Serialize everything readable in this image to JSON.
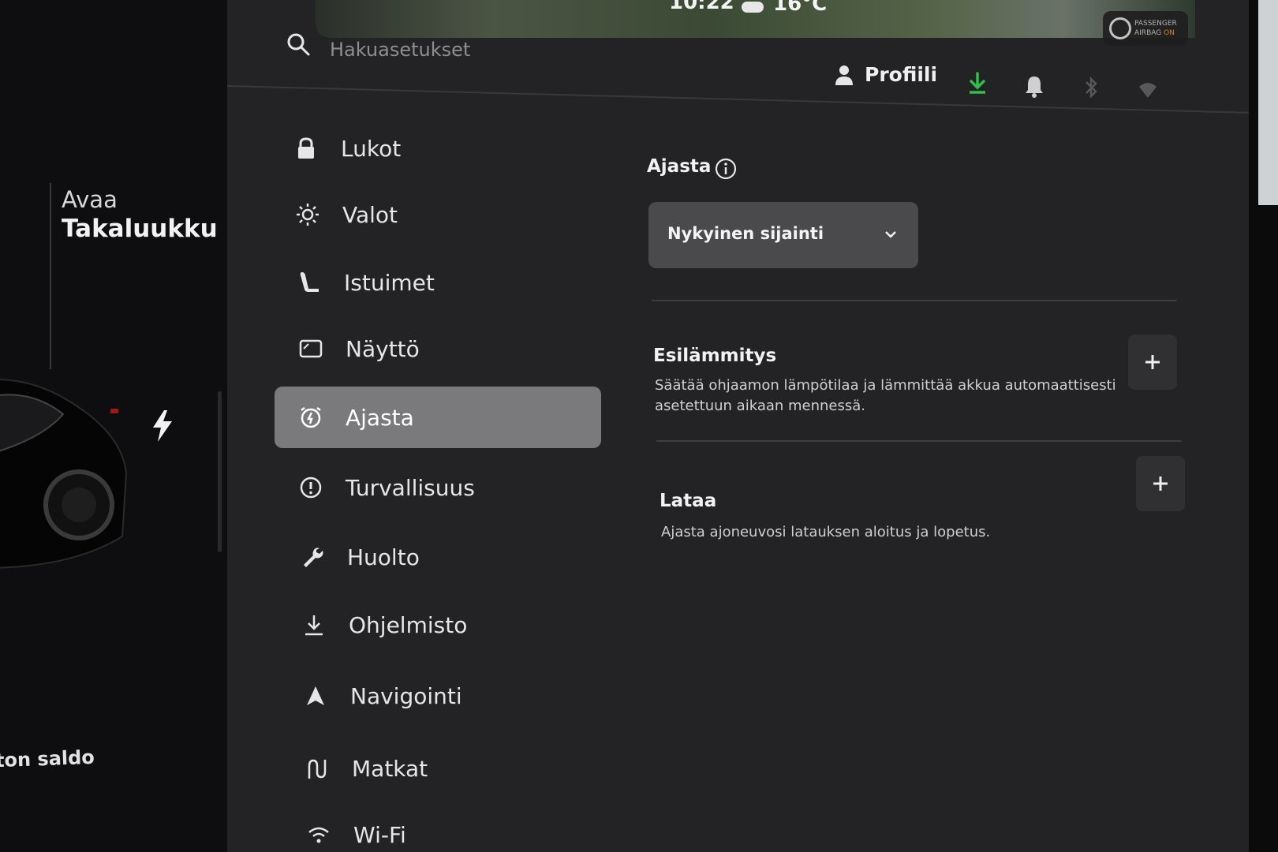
{
  "car_pane": {
    "trunk_action": "Avaa",
    "trunk_name": "Takaluukku",
    "balance_label": "ton saldo"
  },
  "status_bar": {
    "time": "10:22",
    "temperature": "16°C",
    "airbag_line1": "PASSENGER",
    "airbag_line2": "AIRBAG",
    "airbag_state": "ON"
  },
  "search": {
    "placeholder": "Hakuasetukset"
  },
  "header": {
    "profile_label": "Profiili"
  },
  "nav": {
    "items": [
      {
        "label": "Lukot",
        "icon": "lock-icon"
      },
      {
        "label": "Valot",
        "icon": "sun-icon"
      },
      {
        "label": "Istuimet",
        "icon": "seat-icon"
      },
      {
        "label": "Näyttö",
        "icon": "display-icon"
      },
      {
        "label": "Ajasta",
        "icon": "alarm-clock-icon",
        "active": true
      },
      {
        "label": "Turvallisuus",
        "icon": "alert-circle-icon"
      },
      {
        "label": "Huolto",
        "icon": "wrench-icon"
      },
      {
        "label": "Ohjelmisto",
        "icon": "download-icon"
      },
      {
        "label": "Navigointi",
        "icon": "navigation-arrow-icon"
      },
      {
        "label": "Matkat",
        "icon": "trips-icon"
      },
      {
        "label": "Wi-Fi",
        "icon": "wifi-icon"
      }
    ]
  },
  "content": {
    "title": "Ajasta",
    "location_dropdown": "Nykyinen sijainti",
    "preheat": {
      "title": "Esilämmitys",
      "description_line1": "Säätää ohjaamon lämpötilaa ja lämmittää akkua automaattisesti",
      "description_line2": "asetettuun aikaan mennessä."
    },
    "charge": {
      "title": "Lataa",
      "description": "Ajasta ajoneuvosi latauksen aloitus ja lopetus."
    }
  },
  "colors": {
    "download_accent": "#2fbf4a",
    "active_nav": "#7a7a7c",
    "panel": "#232325"
  }
}
